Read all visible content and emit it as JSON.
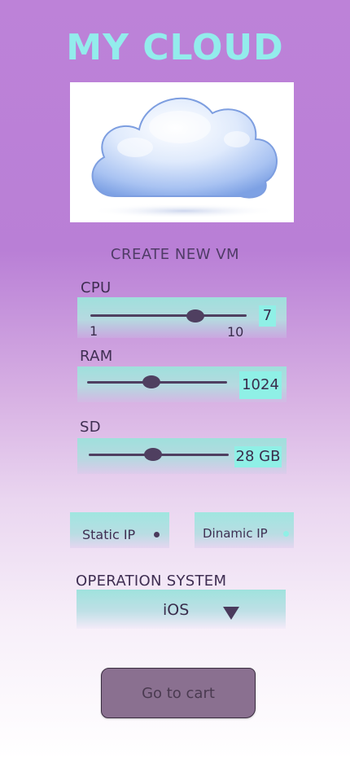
{
  "app": {
    "title": "MY CLOUD"
  },
  "create_vm": {
    "heading": "CREATE NEW VM"
  },
  "cpu": {
    "label": "CPU",
    "min": "1",
    "max": "10",
    "value": "7",
    "level": 0.67
  },
  "ram": {
    "label": "RAM",
    "value": "1024",
    "level": 0.46
  },
  "sd": {
    "label": "SD",
    "value": "28 GB",
    "level": 0.46
  },
  "ip": {
    "static_label": "Static IP",
    "dynamic_label": "Dinamic IP",
    "selected": "static"
  },
  "os": {
    "label": "OPERATION SYSTEM",
    "value": "iOS"
  },
  "cart": {
    "button_label": "Go to cart"
  },
  "colors": {
    "title": "#93ecec",
    "panel": "#9fe0dc",
    "slider": "#4f3f60",
    "button": "#8a7090"
  },
  "icons": {
    "hero": "cloud-icon",
    "dropdown": "triangle-down-icon"
  }
}
